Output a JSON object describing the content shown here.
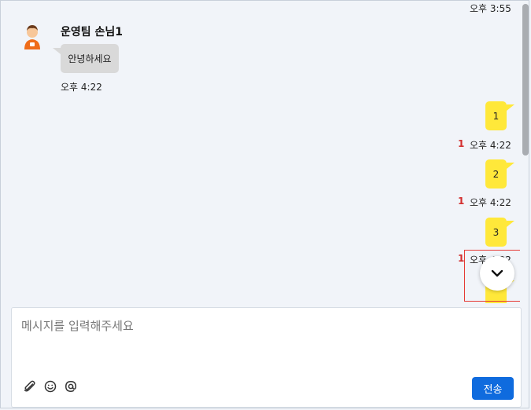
{
  "messages": {
    "top_partial_time": "오후 3:55",
    "incoming": {
      "sender": "운영팀 손님1",
      "text": "안녕하세요",
      "time": "오후 4:22"
    },
    "outgoing": [
      {
        "text": "1",
        "unread": "1",
        "time": "오후 4:22"
      },
      {
        "text": "2",
        "unread": "1",
        "time": "오후 4:22"
      },
      {
        "text": "3",
        "unread": "1",
        "time": "오후 4:22"
      }
    ]
  },
  "composer": {
    "placeholder": "메시지를 입력해주세요",
    "send_label": "전송",
    "icons": [
      "paperclip-icon",
      "smiley-icon",
      "at-sign-icon"
    ]
  },
  "colors": {
    "outgoing_bubble": "#ffe83a",
    "incoming_bubble": "#d9d9d9",
    "unread": "#d32f2f",
    "send_button": "#0f6bde"
  }
}
